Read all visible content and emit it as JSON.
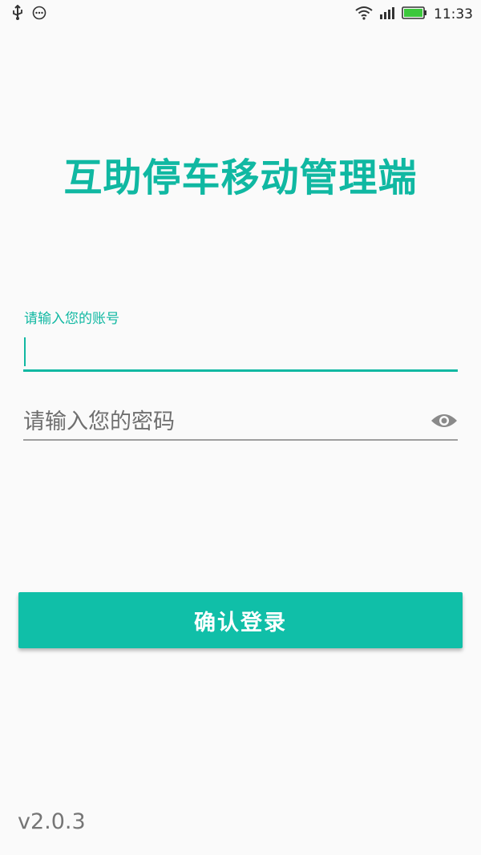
{
  "status_bar": {
    "time": "11:33",
    "icons": [
      "usb-icon",
      "message-icon",
      "wifi-icon",
      "signal-icon",
      "battery-icon"
    ]
  },
  "app": {
    "title": "互助停车移动管理端"
  },
  "login_form": {
    "account_label": "请输入您的账号",
    "account_value": "",
    "password_placeholder": "请输入您的密码",
    "password_value": "",
    "password_toggle_icon": "eye-icon",
    "submit_label": "确认登录"
  },
  "footer": {
    "version": "v2.0.3"
  },
  "colors": {
    "accent": "#10b8a2",
    "button": "#10bfa8",
    "background": "#fafafa",
    "underline_inactive": "#9e9e9e"
  }
}
